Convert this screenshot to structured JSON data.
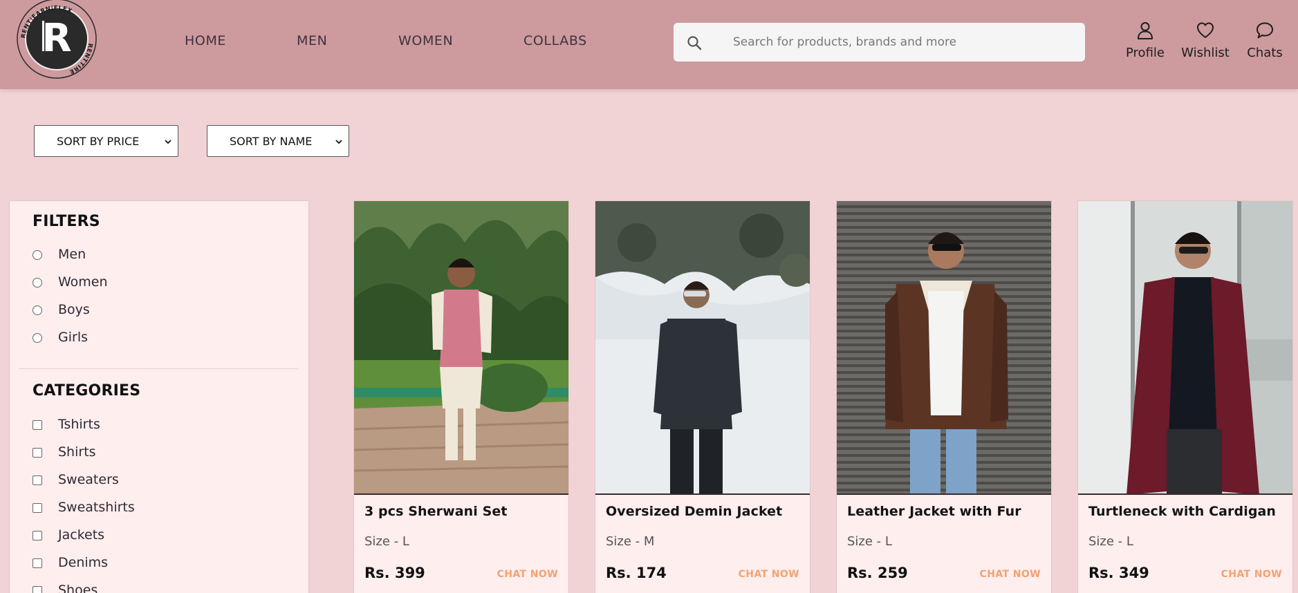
{
  "brand": {
    "logo_letter": "R",
    "logo_ring_top": "RENT|EARN|FLEX",
    "logo_ring_bottom": "RENTTIRE"
  },
  "nav": {
    "items": [
      {
        "label": "HOME"
      },
      {
        "label": "MEN"
      },
      {
        "label": "WOMEN"
      },
      {
        "label": "COLLABS"
      }
    ]
  },
  "search": {
    "placeholder": "Search for products, brands and more",
    "icon": "search-icon"
  },
  "header_actions": [
    {
      "label": "Profile",
      "icon": "person-icon"
    },
    {
      "label": "Wishlist",
      "icon": "heart-icon"
    },
    {
      "label": "Chats",
      "icon": "chat-bubble-icon"
    }
  ],
  "sort": {
    "price_label": "SORT BY PRICE",
    "name_label": "SORT BY NAME"
  },
  "filters": {
    "heading": "FILTERS",
    "options": [
      "Men",
      "Women",
      "Boys",
      "Girls"
    ]
  },
  "categories": {
    "heading": "CATEGORIES",
    "options": [
      "Tshirts",
      "Shirts",
      "Sweaters",
      "Sweatshirts",
      "Jackets",
      "Denims",
      "Shoes"
    ]
  },
  "products": [
    {
      "title": "3 pcs Sherwani Set",
      "size": "Size - L",
      "price": "Rs. 399",
      "cta": "CHAT NOW"
    },
    {
      "title": "Oversized Demin Jacket",
      "size": "Size - M",
      "price": "Rs. 174",
      "cta": "CHAT NOW"
    },
    {
      "title": "Leather Jacket with Fur",
      "size": "Size - L",
      "price": "Rs. 259",
      "cta": "CHAT NOW"
    },
    {
      "title": "Turtleneck with Cardigan",
      "size": "Size - L",
      "price": "Rs. 349",
      "cta": "CHAT NOW"
    }
  ],
  "colors": {
    "header_bg": "#cd9a9e",
    "page_bg": "#f1d3d6",
    "panel_bg": "#feeeee",
    "cta": "#f4a26f"
  }
}
